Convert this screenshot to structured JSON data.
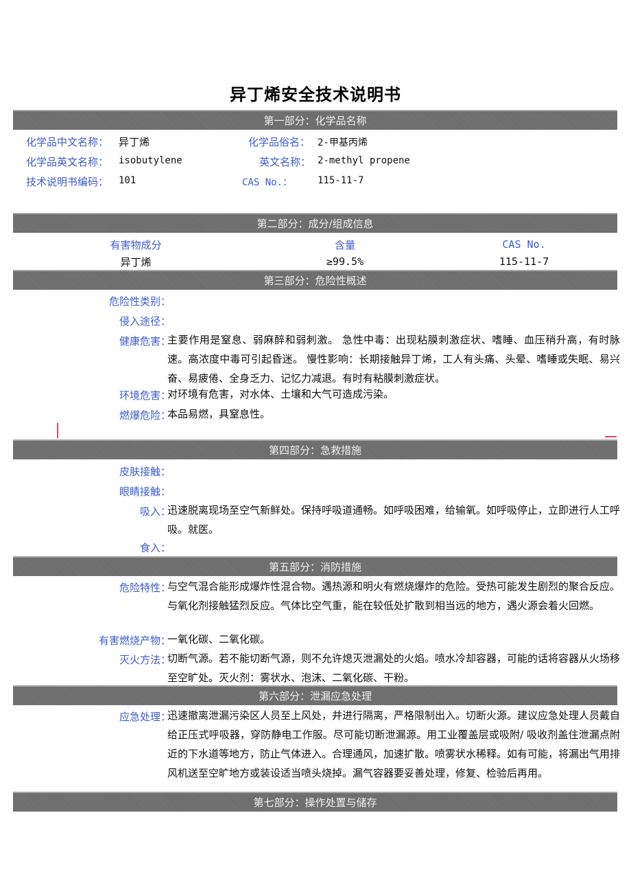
{
  "document": {
    "title": "异丁烯安全技术说明书"
  },
  "sections": {
    "s1": {
      "header": "第一部分：化学品名称",
      "fields": {
        "cn_name_label": "化学品中文名称：",
        "cn_name_value": "异丁烯",
        "common_name_label": "化学品俗名：",
        "common_name_value": "2-甲基丙烯",
        "en_name_label": "化学品英文名称：",
        "en_name_value": "isobutylene",
        "en_alias_label": "英文名称：",
        "en_alias_value": "2-methyl propene",
        "code_label": "技术说明书编码：",
        "code_value": "101",
        "cas_label": "CAS No.：",
        "cas_value": "115-11-7"
      }
    },
    "s2": {
      "header": "第二部分：成分/组成信息",
      "columns": [
        "有害物成分",
        "含量",
        "CAS No."
      ],
      "rows": [
        [
          "异丁烯",
          "≥99.5%",
          "115-11-7"
        ]
      ]
    },
    "s3": {
      "header": "第三部分：危险性概述",
      "items": [
        {
          "label": "危险性类别：",
          "value": ""
        },
        {
          "label": "侵入途径：",
          "value": ""
        },
        {
          "label": "健康危害：",
          "value": "主要作用是窒息、弱麻醉和弱刺激。 急性中毒：出现粘膜刺激症状、嗜睡、血压稍升高，有时脉速。高浓度中毒可引起昏迷。 慢性影响：长期接触异丁烯，工人有头痛、头晕、嗜睡或失眠、易兴奋、易疲倦、全身乏力、记忆力减退。有时有粘膜刺激症状。"
        },
        {
          "label": "环境危害：",
          "value": "对环境有危害，对水体、土壤和大气可造成污染。"
        },
        {
          "label": "燃爆危险：",
          "value": "本品易燃，具窒息性。"
        }
      ]
    },
    "s4": {
      "header": "第四部分：急救措施",
      "items": [
        {
          "label": "皮肤接触：",
          "value": ""
        },
        {
          "label": "眼睛接触：",
          "value": ""
        },
        {
          "label": "吸入：",
          "value": "迅速脱离现场至空气新鲜处。保持呼吸道通畅。如呼吸困难，给输氧。如呼吸停止，立即进行人工呼吸。就医。"
        },
        {
          "label": "食入：",
          "value": ""
        }
      ]
    },
    "s5": {
      "header": "第五部分：消防措施",
      "items": [
        {
          "label": "危险特性：",
          "value": "与空气混合能形成爆炸性混合物。遇热源和明火有燃烧爆炸的危险。受热可能发生剧烈的聚合反应。与氧化剂接触猛烈反应。气体比空气重，能在较低处扩散到相当远的地方，遇火源会着火回燃。"
        },
        {
          "label": "有害燃烧产物：",
          "value": "一氧化碳、二氧化碳。"
        },
        {
          "label": "灭火方法：",
          "value": "切断气源。若不能切断气源，则不允许熄灭泄漏处的火焰。喷水冷却容器，可能的话将容器从火场移至空旷处。灭火剂：雾状水、泡沫、二氧化碳、干粉。"
        }
      ]
    },
    "s6": {
      "header": "第六部分：泄漏应急处理",
      "items": [
        {
          "label": "应急处理：",
          "value": "迅速撤离泄漏污染区人员至上风处，并进行隔离，严格限制出入。切断火源。建议应急处理人员戴自给正压式呼吸器，穿防静电工作服。尽可能切断泄漏源。用工业覆盖层或吸附/ 吸收剂盖住泄漏点附近的下水道等地方，防止气体进入。合理通风，加速扩散。喷雾状水稀释。如有可能，将漏出气用排风机送至空旷地方或装设适当喷头烧掉。漏气容器要妥善处理，修复、检验后再用。"
        }
      ]
    },
    "s7": {
      "header": "第七部分：操作处置与储存"
    }
  }
}
